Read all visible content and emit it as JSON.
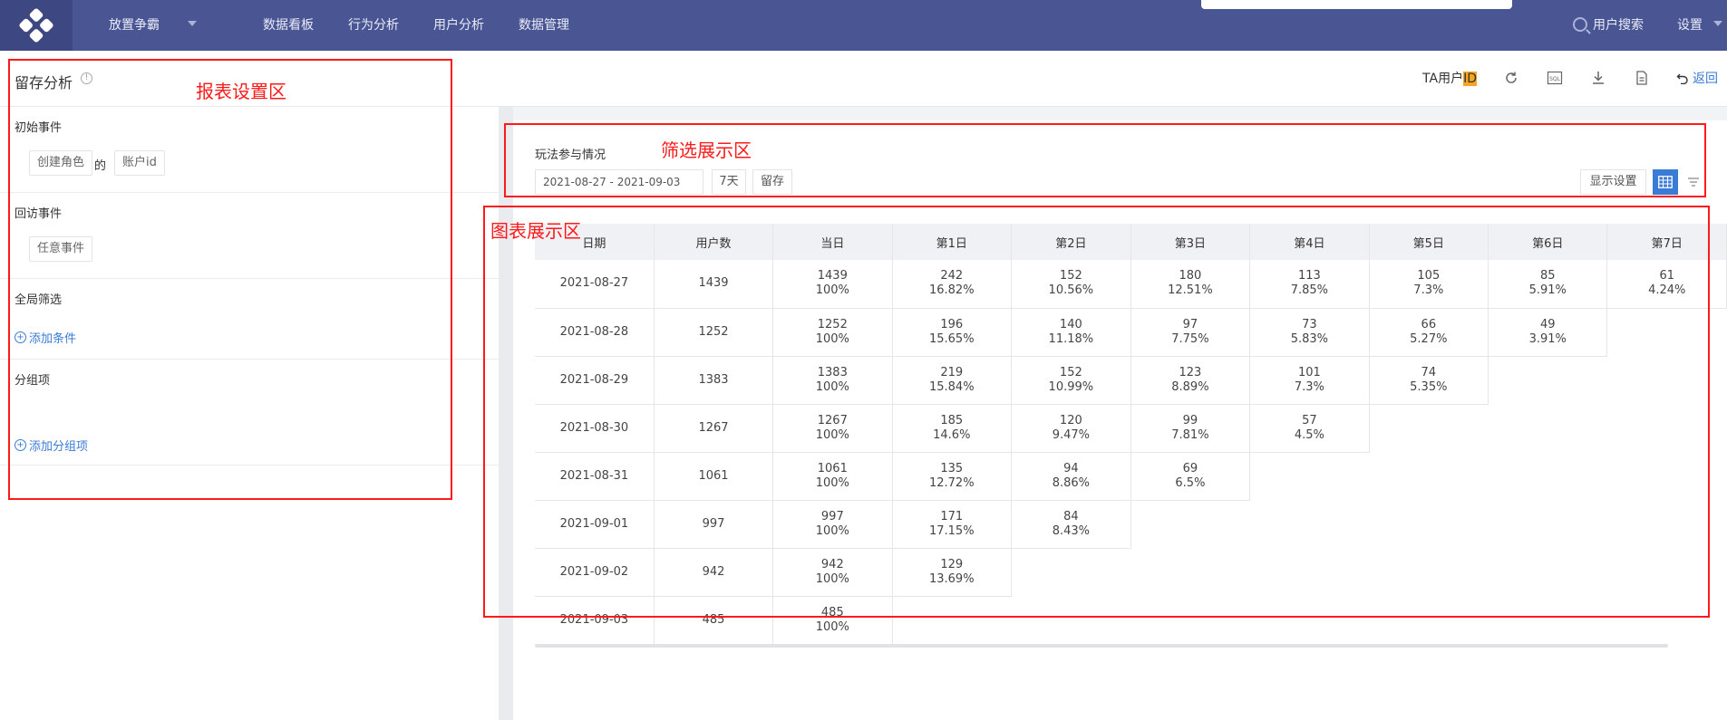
{
  "nav": {
    "project": "放置争霸",
    "items": [
      "数据看板",
      "行为分析",
      "用户分析",
      "数据管理"
    ],
    "user_search": "用户搜索",
    "settings": "设置"
  },
  "title": {
    "text": "留存分析",
    "ta_prefix": "TA用户",
    "ta_highlight": "ID",
    "back": "返回"
  },
  "left": {
    "initial_event_title": "初始事件",
    "initial_event": "创建角色",
    "de": "的",
    "id_field": "账户id",
    "return_event_title": "回访事件",
    "return_event": "任意事件",
    "global_filter_title": "全局筛选",
    "add_condition": "添加条件",
    "group_title": "分组项",
    "add_group": "添加分组项"
  },
  "filter": {
    "title": "玩法参与情况",
    "date_range": "2021-08-27 - 2021-09-03",
    "period": "7天",
    "mode": "留存",
    "display_settings": "显示设置"
  },
  "table": {
    "headers": [
      "日期",
      "用户数",
      "当日",
      "第1日",
      "第2日",
      "第3日",
      "第4日",
      "第5日",
      "第6日",
      "第7日"
    ],
    "rows": [
      {
        "date": "2021-08-27",
        "users": "1439",
        "cells": [
          [
            "1439",
            "100%"
          ],
          [
            "242",
            "16.82%"
          ],
          [
            "152",
            "10.56%"
          ],
          [
            "180",
            "12.51%"
          ],
          [
            "113",
            "7.85%"
          ],
          [
            "105",
            "7.3%"
          ],
          [
            "85",
            "5.91%"
          ],
          [
            "61",
            "4.24%"
          ]
        ]
      },
      {
        "date": "2021-08-28",
        "users": "1252",
        "cells": [
          [
            "1252",
            "100%"
          ],
          [
            "196",
            "15.65%"
          ],
          [
            "140",
            "11.18%"
          ],
          [
            "97",
            "7.75%"
          ],
          [
            "73",
            "5.83%"
          ],
          [
            "66",
            "5.27%"
          ],
          [
            "49",
            "3.91%"
          ]
        ]
      },
      {
        "date": "2021-08-29",
        "users": "1383",
        "cells": [
          [
            "1383",
            "100%"
          ],
          [
            "219",
            "15.84%"
          ],
          [
            "152",
            "10.99%"
          ],
          [
            "123",
            "8.89%"
          ],
          [
            "101",
            "7.3%"
          ],
          [
            "74",
            "5.35%"
          ]
        ]
      },
      {
        "date": "2021-08-30",
        "users": "1267",
        "cells": [
          [
            "1267",
            "100%"
          ],
          [
            "185",
            "14.6%"
          ],
          [
            "120",
            "9.47%"
          ],
          [
            "99",
            "7.81%"
          ],
          [
            "57",
            "4.5%"
          ]
        ]
      },
      {
        "date": "2021-08-31",
        "users": "1061",
        "cells": [
          [
            "1061",
            "100%"
          ],
          [
            "135",
            "12.72%"
          ],
          [
            "94",
            "8.86%"
          ],
          [
            "69",
            "6.5%"
          ]
        ]
      },
      {
        "date": "2021-09-01",
        "users": "997",
        "cells": [
          [
            "997",
            "100%"
          ],
          [
            "171",
            "17.15%"
          ],
          [
            "84",
            "8.43%"
          ]
        ]
      },
      {
        "date": "2021-09-02",
        "users": "942",
        "cells": [
          [
            "942",
            "100%"
          ],
          [
            "129",
            "13.69%"
          ]
        ]
      },
      {
        "date": "2021-09-03",
        "users": "485",
        "cells": [
          [
            "485",
            "100%"
          ]
        ]
      }
    ]
  },
  "annotations": {
    "report_settings": "报表设置区",
    "filter_display": "筛选展示区",
    "chart_display": "图表展示区"
  },
  "colors": {
    "nav_bg": "#4a5694",
    "accent": "#3a7bd5",
    "annotation": "#ff1a1a",
    "id_highlight": "#f5a623"
  }
}
